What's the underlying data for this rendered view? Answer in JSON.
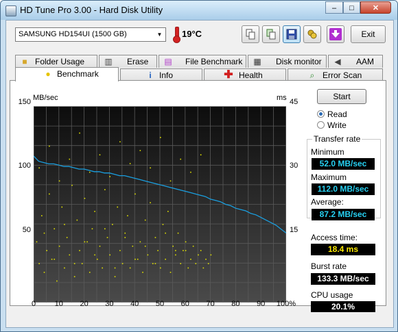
{
  "window": {
    "title": "HD Tune Pro 3.00 - Hard Disk Utility",
    "min_label": "–",
    "max_label": "□",
    "close_label": "✕"
  },
  "toolbar": {
    "drive": "SAMSUNG HD154UI (1500 GB)",
    "temperature": "19°C",
    "exit_label": "Exit",
    "icons": [
      "copy-icon",
      "copy-info-icon",
      "save-icon",
      "options-icon",
      "down-arrow-icon"
    ]
  },
  "tabs_top": [
    {
      "label": "Folder Usage",
      "icon": "folder-icon"
    },
    {
      "label": "Erase",
      "icon": "trash-icon"
    },
    {
      "label": "File Benchmark",
      "icon": "file-benchmark-icon"
    },
    {
      "label": "Disk monitor",
      "icon": "disk-monitor-icon"
    },
    {
      "label": "AAM",
      "icon": "speaker-icon"
    }
  ],
  "tabs_bottom": [
    {
      "label": "Benchmark",
      "icon": "benchmark-icon",
      "active": true
    },
    {
      "label": "Info",
      "icon": "info-icon"
    },
    {
      "label": "Health",
      "icon": "health-cross-icon"
    },
    {
      "label": "Error Scan",
      "icon": "magnifier-icon"
    }
  ],
  "chart_data": {
    "type": "line",
    "ylabel_left": "MB/sec",
    "ylabel_right": "ms",
    "y_ticks_left": [
      "150",
      "100",
      "50"
    ],
    "y_ticks_right": [
      "45",
      "30",
      "15"
    ],
    "ylim_left": [
      0,
      150
    ],
    "ylim_right": [
      0,
      45
    ],
    "x_ticks": [
      "0",
      "10",
      "20",
      "30",
      "40",
      "50",
      "60",
      "70",
      "80",
      "90",
      "100%"
    ],
    "xlim": [
      0,
      100
    ],
    "grid": true,
    "background": "#1b1b1b",
    "series": [
      {
        "style": "line",
        "color": "#1a9fe0",
        "axis": "left",
        "x": [
          0,
          2,
          4,
          6,
          8,
          10,
          12,
          14,
          16,
          18,
          20,
          22,
          24,
          26,
          28,
          30,
          32,
          34,
          36,
          38,
          40,
          42,
          44,
          46,
          48,
          50,
          52,
          54,
          56,
          58,
          60,
          62,
          64,
          66,
          68,
          70,
          72,
          74,
          76,
          78,
          80,
          82,
          84,
          86,
          88,
          90,
          92,
          94,
          96,
          98,
          100
        ],
        "values": [
          112,
          108,
          107,
          106,
          106,
          105,
          104,
          104,
          103,
          102,
          102,
          101,
          100,
          100,
          99,
          99,
          98,
          97,
          97,
          96,
          95,
          94,
          93,
          92,
          91,
          90,
          89,
          88,
          87,
          86,
          85,
          84,
          83,
          82,
          81,
          79,
          78,
          77,
          75,
          74,
          72,
          71,
          70,
          68,
          67,
          65,
          63,
          61,
          59,
          56,
          53
        ]
      },
      {
        "style": "scatter",
        "name": "Access time",
        "color": "#e0e000",
        "axis": "right",
        "x": [
          1,
          2,
          3,
          4,
          5,
          6,
          7,
          8,
          9,
          10,
          11,
          12,
          13,
          14,
          15,
          16,
          17,
          18,
          19,
          20,
          21,
          22,
          23,
          24,
          25,
          26,
          27,
          28,
          29,
          30,
          31,
          32,
          33,
          34,
          35,
          36,
          37,
          38,
          39,
          40,
          41,
          42,
          43,
          44,
          45,
          46,
          47,
          48,
          49,
          50,
          51,
          52,
          53,
          54,
          55,
          56,
          57,
          58,
          59,
          60,
          61,
          62,
          63,
          64,
          65,
          66,
          67,
          68,
          69,
          70,
          2,
          6,
          10,
          14,
          18,
          22,
          26,
          30,
          34,
          38,
          42,
          46,
          50,
          54,
          58,
          62,
          66,
          4,
          12,
          20,
          28,
          36,
          44,
          52,
          60,
          8,
          16,
          24,
          32,
          40,
          48,
          56
        ],
        "values": [
          14,
          9,
          20,
          7,
          12,
          25,
          10,
          17,
          5,
          13,
          22,
          8,
          15,
          11,
          27,
          6,
          19,
          12,
          9,
          24,
          14,
          7,
          17,
          21,
          10,
          13,
          8,
          26,
          15,
          11,
          18,
          6,
          22,
          12,
          9,
          16,
          20,
          8,
          13,
          25,
          10,
          14,
          7,
          19,
          11,
          23,
          9,
          15,
          12,
          8,
          18,
          10,
          21,
          7,
          13,
          11,
          16,
          9,
          12,
          14,
          8,
          10,
          13,
          9,
          11,
          12,
          8,
          10,
          9,
          11,
          31,
          36,
          28,
          33,
          39,
          30,
          34,
          29,
          37,
          32,
          35,
          31,
          38,
          28,
          33,
          30,
          34,
          16,
          18,
          14,
          17,
          15,
          13,
          16,
          12,
          10,
          9,
          11,
          8,
          10,
          9,
          12
        ]
      }
    ]
  },
  "controls": {
    "start_label": "Start",
    "read_label": "Read",
    "write_label": "Write",
    "read_checked": true
  },
  "transfer_rate": {
    "title": "Transfer rate",
    "minimum_label": "Minimum",
    "minimum_value": "52.0 MB/sec",
    "maximum_label": "Maximum",
    "maximum_value": "112.0 MB/sec",
    "average_label": "Average:",
    "average_value": "87.2 MB/sec"
  },
  "stats": {
    "access_label": "Access time:",
    "access_value": "18.4 ms",
    "burst_label": "Burst rate",
    "burst_value": "133.3 MB/sec",
    "cpu_label": "CPU usage",
    "cpu_value": "20.1%"
  }
}
